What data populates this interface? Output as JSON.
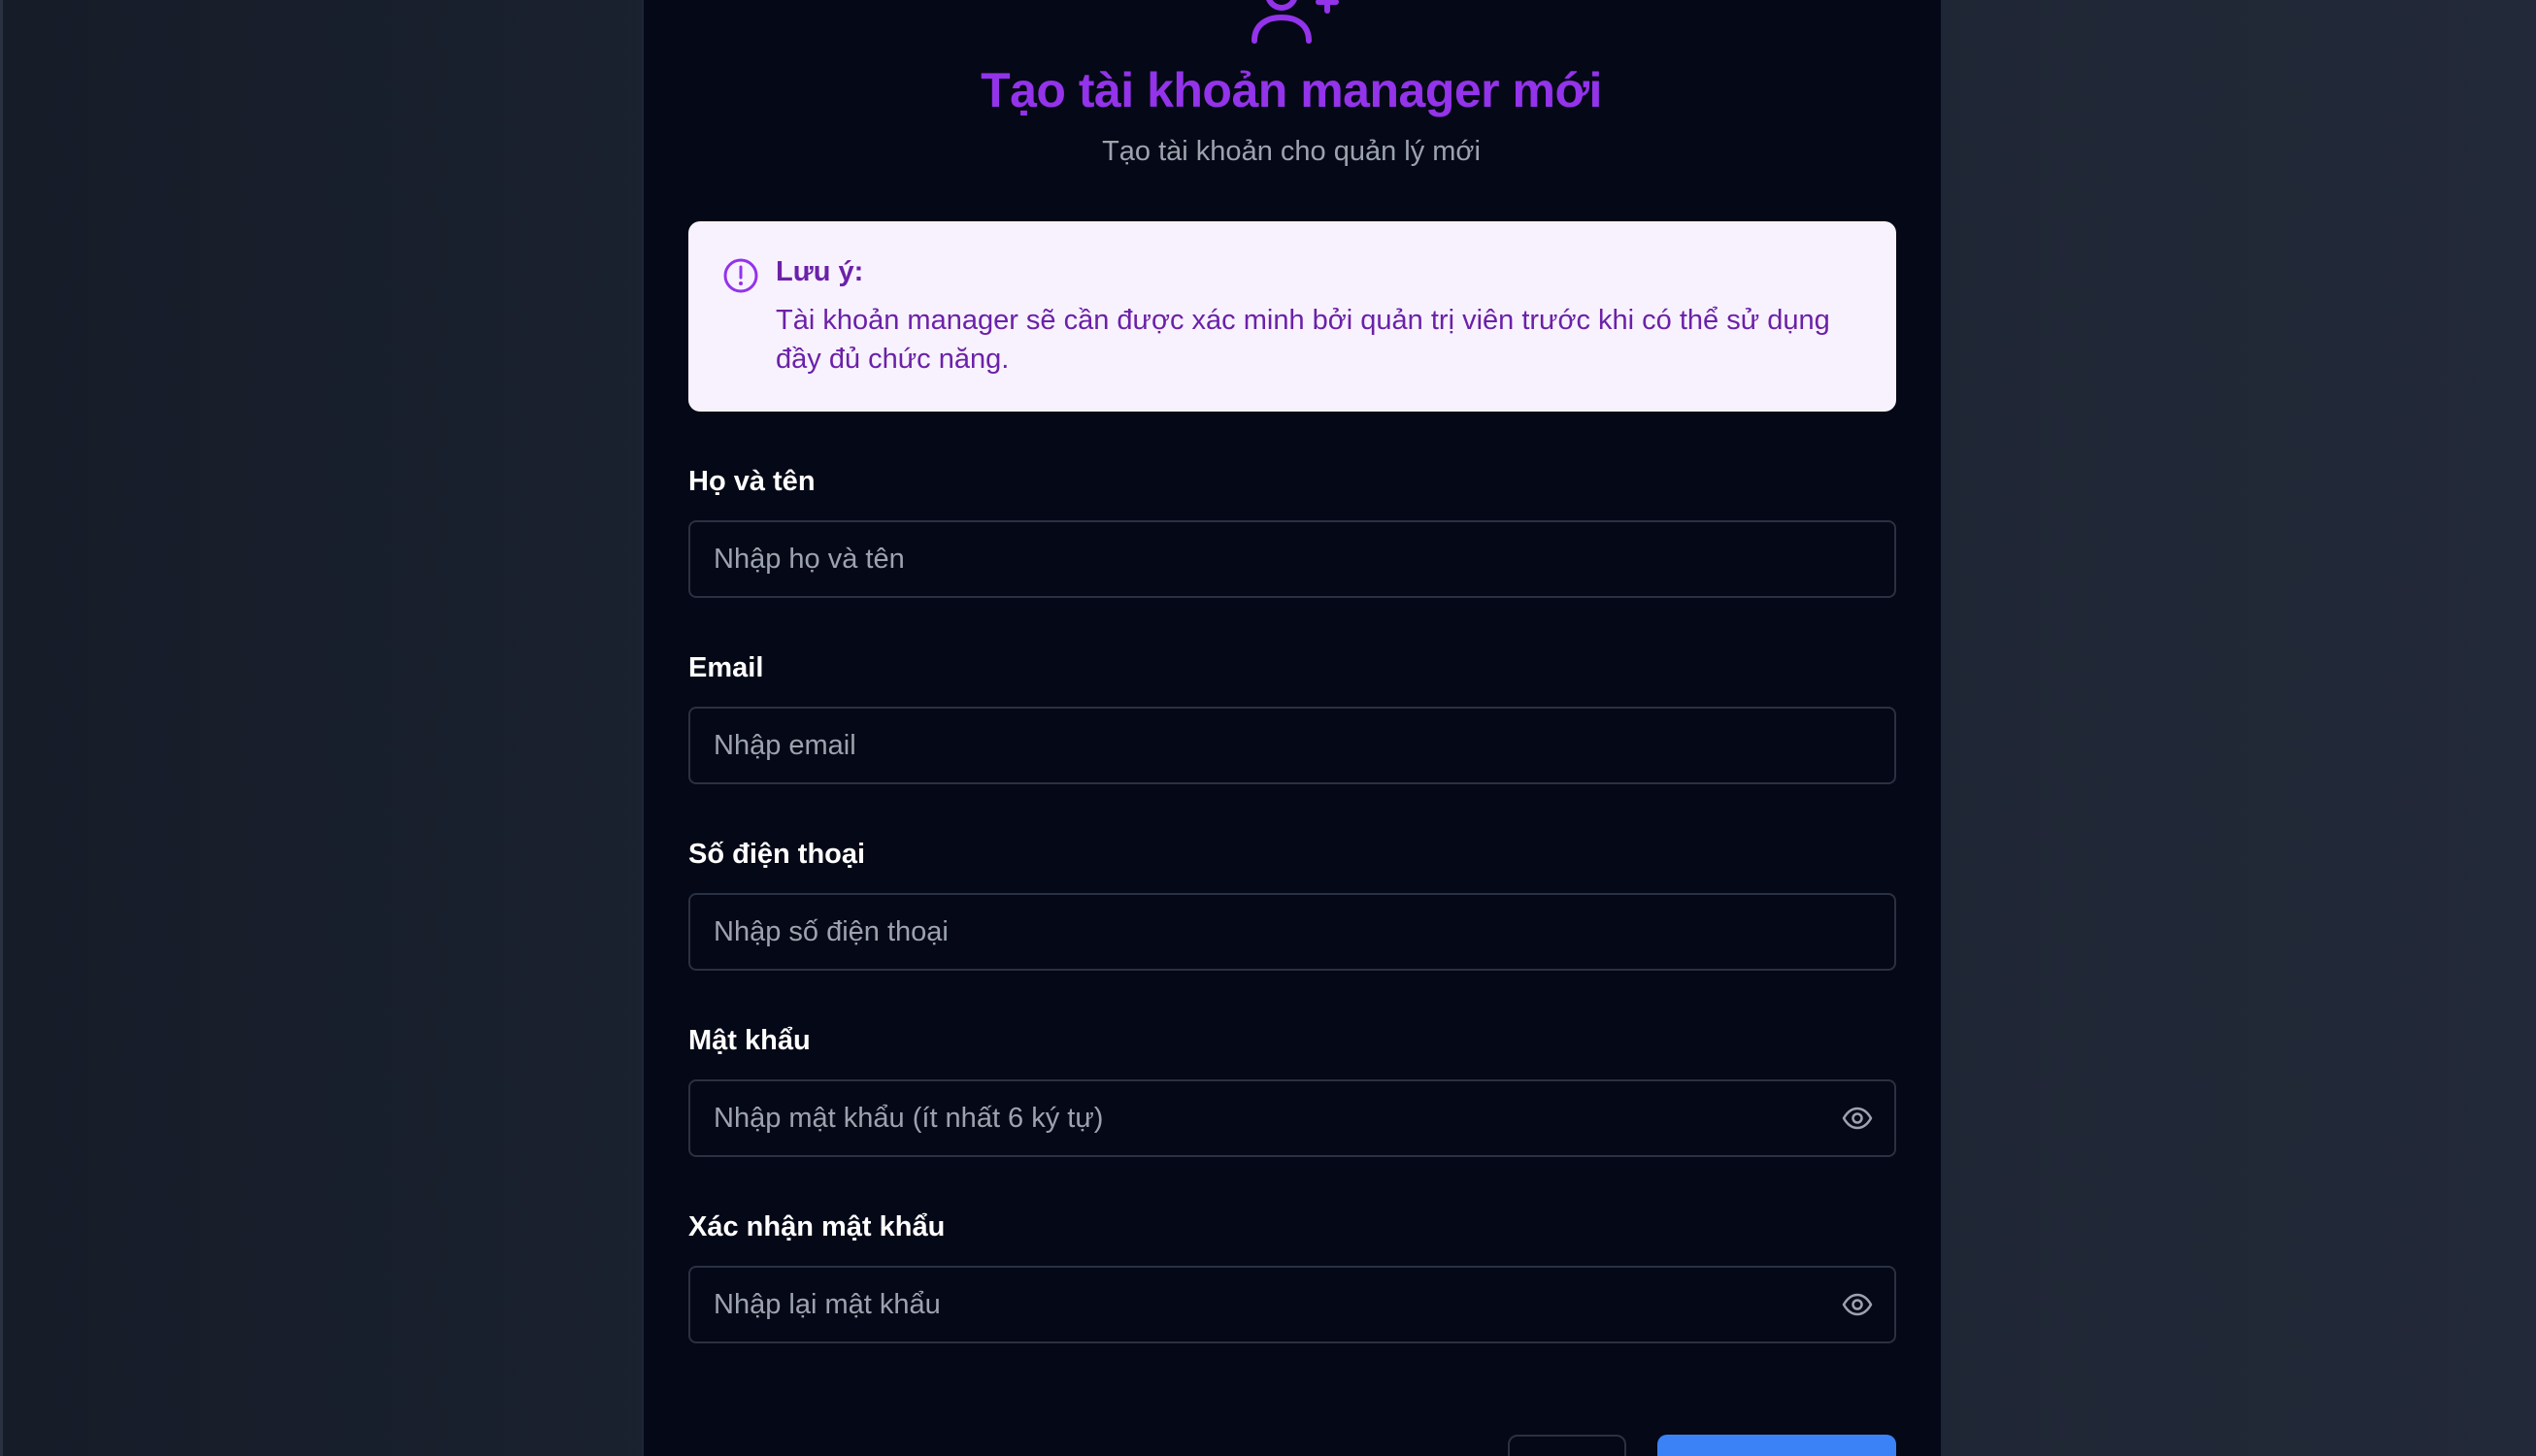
{
  "dialog": {
    "title": "Tạo tài khoản manager mới",
    "subtitle": "Tạo tài khoản cho quản lý mới",
    "header_icon": "user-plus-icon"
  },
  "notice": {
    "icon": "alert-circle-icon",
    "title": "Lưu ý:",
    "text": "Tài khoản manager sẽ cần được xác minh bởi quản trị viên trước khi có thể sử dụng đầy đủ chức năng."
  },
  "form": {
    "full_name": {
      "label": "Họ và tên",
      "placeholder": "Nhập họ và tên",
      "value": ""
    },
    "email": {
      "label": "Email",
      "placeholder": "Nhập email",
      "value": ""
    },
    "phone": {
      "label": "Số điện thoại",
      "placeholder": "Nhập số điện thoại",
      "value": ""
    },
    "password": {
      "label": "Mật khẩu",
      "placeholder": "Nhập mật khẩu (ít nhất 6 ký tự)",
      "value": "",
      "toggle_icon": "eye-icon"
    },
    "confirm_password": {
      "label": "Xác nhận mật khẩu",
      "placeholder": "Nhập lại mật khẩu",
      "value": "",
      "toggle_icon": "eye-icon"
    }
  },
  "colors": {
    "accent": "#9333ea",
    "notice_bg": "#f8f2fe",
    "notice_text": "#6b21a8",
    "dialog_bg": "#050816",
    "primary_button": "#3b82f6"
  }
}
